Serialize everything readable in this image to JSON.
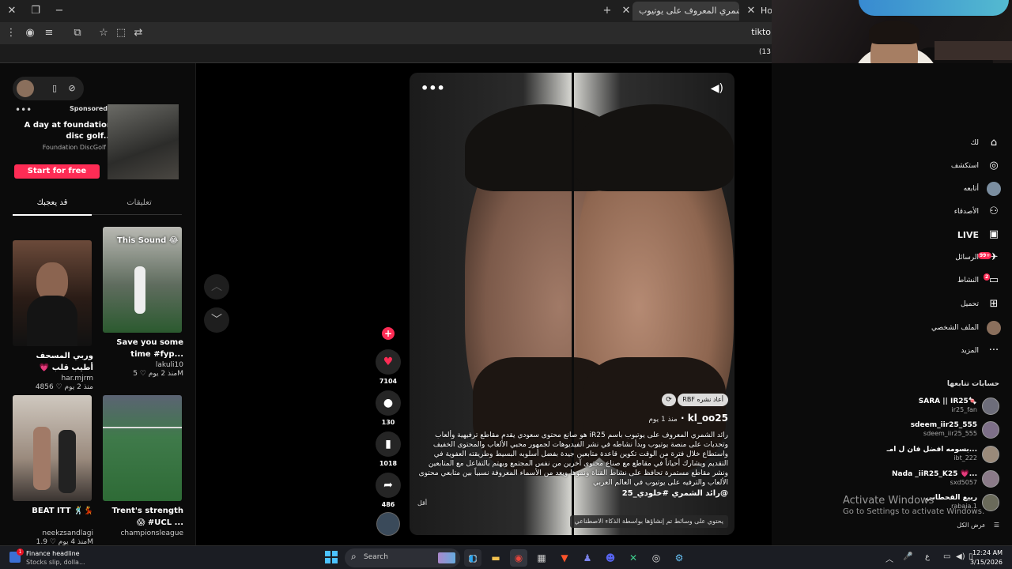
{
  "browser": {
    "tabs": [
      {
        "label": "راند الشمري المعروف على يوتيوب",
        "active": true
      },
      {
        "label": "Hon",
        "active": false
      }
    ],
    "address_partial": "tikto",
    "bookmark_partial": "(13"
  },
  "left": {
    "ad": {
      "sponsored": "Sponsored",
      "title": "A day at foundation disc golf...",
      "brand": "Foundation DiscGolf",
      "cta": "Start for free"
    },
    "tabs": [
      "قد يعجبك",
      "تعليقات"
    ],
    "cards": [
      {
        "caption": "وربي المسحف أطيب قلب 💗 مؤثري...",
        "author": "har.mjrm",
        "likes": "4856",
        "age": "منذ 2 يوم"
      },
      {
        "caption": "Save you some time #fyp...",
        "author": "lakuli10",
        "likes": "5M",
        "age": "منذ 2 يوم",
        "overlay": "This Sound 😂"
      },
      {
        "caption": "BEAT ITT 🕺💃",
        "author": "neekzsandlagi",
        "likes": "1.9M",
        "age": "منذ 4 يوم"
      },
      {
        "caption": "Trent's strength 😱 #UCL ...",
        "author": "championsleague",
        "likes": "",
        "age": ""
      }
    ]
  },
  "video": {
    "username": "kl_oo25",
    "age": "منذ 1 يوم",
    "repost": "RBF أعاد نشره",
    "description": "رائد الشمري المعروف على يوتيوب باسم iR25 هو صانع محتوى سعودي يقدم مقاطع ترفيهية وألعاب وتحديات على منصة يوتيوب وبدأ نشاطه في نشر الفيديوهات لجمهور محبي الألعاب والمحتوى الخفيف واستطاع خلال فترة من الوقت تكوين قاعدة متابعين جيدة بفضل أسلوبه البسيط وطريقته العفوية في التقديم ويشارك أحياناً في مقاطع مع صناع محتوى آخرين من نفس المجتمع ويهتم بالتفاعل مع المتابعين ونشر مقاطع مستمرة تحافظ على نشاط القناة ونموها ويعد من الأسماء المعروفة نسبياً بين متابعي محتوى الألعاب والترفيه على يوتيوب في العالم العربي",
    "hashtags": "@رائد الشمري  #خلودي_25",
    "collapse": "أقل",
    "ai_label": "يحتوي على وسائط تم إنشاؤها بواسطة الذكاء الاصطناعي",
    "likes": "7104",
    "comments": "130",
    "saves": "1018",
    "shares": "486"
  },
  "nav": [
    {
      "label": "لك",
      "icon": "home-icon"
    },
    {
      "label": "استكشف",
      "icon": "compass-icon"
    },
    {
      "label": "أتابعه",
      "icon": "avatar-icon"
    },
    {
      "label": "الأصدقاء",
      "icon": "friends-icon"
    },
    {
      "label": "LIVE",
      "icon": "live-icon"
    },
    {
      "label": "الرسائل",
      "icon": "messages-icon",
      "badge": "99+"
    },
    {
      "label": "النشاط",
      "icon": "activity-icon",
      "badge": "2"
    },
    {
      "label": "تحميل",
      "icon": "upload-icon"
    },
    {
      "label": "الملف الشخصي",
      "icon": "profile-icon"
    },
    {
      "label": "المزيد",
      "icon": "more-icon"
    }
  ],
  "following": {
    "title": "حسابات تتابعها",
    "accounts": [
      {
        "name": "SARA || IR25🍬",
        "handle": "ir25_fan"
      },
      {
        "name": "sdeem_iir25_555",
        "handle": "sdeem_iir25_555"
      },
      {
        "name": "بسومه افضل فان ل امـ...",
        "handle": "ibt_222"
      },
      {
        "name": "Nada _iiR25_K25 💗...",
        "handle": "sxd5057"
      },
      {
        "name": "ربيع القحطاني",
        "handle": "rabaia.1"
      }
    ],
    "see_all": "عرض الكل"
  },
  "windows": {
    "activate_title": "Activate Windows",
    "activate_sub": "Go to Settings to activate Windows.",
    "news_title": "Finance headline",
    "news_sub": "Stocks slip, dolla...",
    "news_badge": "1",
    "search_placeholder": "Search",
    "lang": "ع",
    "time": "12:24 AM",
    "date": "3/15/2026"
  },
  "colors": {
    "accent": "#fe2c55",
    "windows_blue": "#4cc2ff"
  }
}
